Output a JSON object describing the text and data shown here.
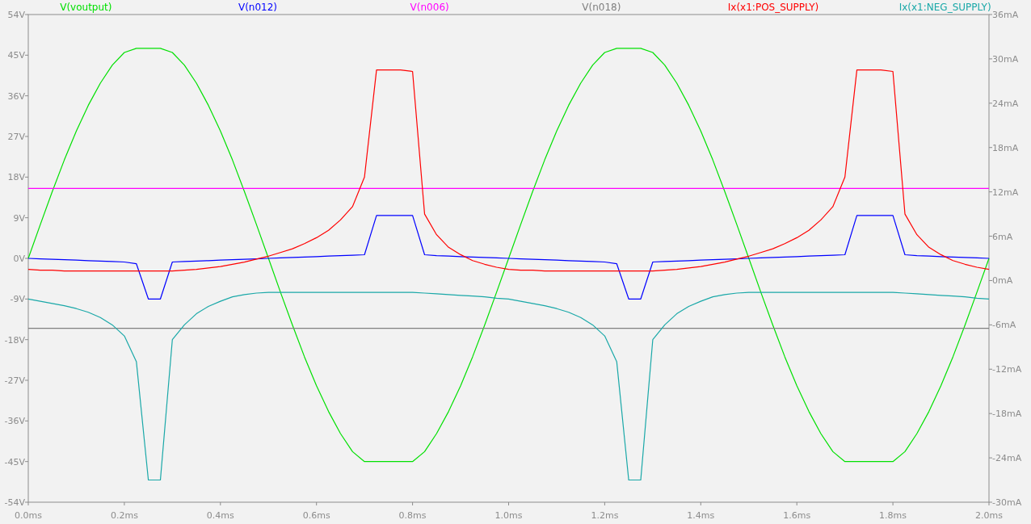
{
  "plot": {
    "chart_data": {
      "type": "line",
      "xlim": [
        0,
        2
      ],
      "ylim": [
        -54,
        54
      ],
      "y2lim": [
        -30,
        36
      ],
      "xticks": [
        {
          "value": 0,
          "label": "0.0ms"
        },
        {
          "value": 0.2,
          "label": "0.2ms"
        },
        {
          "value": 0.4,
          "label": "0.4ms"
        },
        {
          "value": 0.6,
          "label": "0.6ms"
        },
        {
          "value": 0.8,
          "label": "0.8ms"
        },
        {
          "value": 1.0,
          "label": "1.0ms"
        },
        {
          "value": 1.2,
          "label": "1.2ms"
        },
        {
          "value": 1.4,
          "label": "1.4ms"
        },
        {
          "value": 1.6,
          "label": "1.6ms"
        },
        {
          "value": 1.8,
          "label": "1.8ms"
        },
        {
          "value": 2.0,
          "label": "2.0ms"
        }
      ],
      "yticks": [
        {
          "value": 54,
          "label": "54V"
        },
        {
          "value": 45,
          "label": "45V"
        },
        {
          "value": 36,
          "label": "36V"
        },
        {
          "value": 27,
          "label": "27V"
        },
        {
          "value": 18,
          "label": "18V"
        },
        {
          "value": 9,
          "label": "9V"
        },
        {
          "value": 0,
          "label": "0V"
        },
        {
          "value": -9,
          "label": "-9V"
        },
        {
          "value": -18,
          "label": "-18V"
        },
        {
          "value": -27,
          "label": "-27V"
        },
        {
          "value": -36,
          "label": "-36V"
        },
        {
          "value": -45,
          "label": "-45V"
        },
        {
          "value": -54,
          "label": "-54V"
        }
      ],
      "y2ticks": [
        {
          "value": 36,
          "label": "36mA"
        },
        {
          "value": 30,
          "label": "30mA"
        },
        {
          "value": 24,
          "label": "24mA"
        },
        {
          "value": 18,
          "label": "18mA"
        },
        {
          "value": 12,
          "label": "12mA"
        },
        {
          "value": 6,
          "label": "6mA"
        },
        {
          "value": 0,
          "label": "0mA"
        },
        {
          "value": -6,
          "label": "-6mA"
        },
        {
          "value": -12,
          "label": "-12mA"
        },
        {
          "value": -18,
          "label": "-18mA"
        },
        {
          "value": -24,
          "label": "-24mA"
        },
        {
          "value": -30,
          "label": "-30mA"
        }
      ],
      "x": [
        0,
        0.025,
        0.05,
        0.075,
        0.1,
        0.125,
        0.15,
        0.175,
        0.2,
        0.225,
        0.25,
        0.275,
        0.3,
        0.325,
        0.35,
        0.375,
        0.4,
        0.425,
        0.45,
        0.475,
        0.5,
        0.525,
        0.55,
        0.575,
        0.6,
        0.625,
        0.65,
        0.675,
        0.7,
        0.725,
        0.75,
        0.775,
        0.8,
        0.825,
        0.85,
        0.875,
        0.9,
        0.925,
        0.95,
        0.975,
        1.0,
        1.025,
        1.05,
        1.075,
        1.1,
        1.125,
        1.15,
        1.175,
        1.2,
        1.225,
        1.25,
        1.275,
        1.3,
        1.325,
        1.35,
        1.375,
        1.4,
        1.425,
        1.45,
        1.475,
        1.5,
        1.525,
        1.55,
        1.575,
        1.6,
        1.625,
        1.65,
        1.675,
        1.7,
        1.725,
        1.75,
        1.775,
        1.8,
        1.825,
        1.85,
        1.875,
        1.9,
        1.925,
        1.95,
        1.975,
        2.0
      ],
      "series": [
        {
          "name": "V(voutput)",
          "color": "#00e000",
          "values": [
            0,
            7.5,
            14.8,
            21.8,
            28.2,
            33.9,
            38.8,
            42.8,
            45.6,
            46.5,
            46.5,
            46.5,
            45.6,
            42.8,
            38.8,
            33.9,
            28.2,
            21.8,
            14.8,
            7.5,
            0,
            -7.5,
            -14.8,
            -21.8,
            -28.2,
            -33.9,
            -38.8,
            -42.8,
            -45,
            -45,
            -45,
            -45,
            -45,
            -42.8,
            -38.8,
            -33.9,
            -28.2,
            -21.8,
            -14.8,
            -7.5,
            0,
            7.5,
            14.8,
            21.8,
            28.2,
            33.9,
            38.8,
            42.8,
            45.6,
            46.5,
            46.5,
            46.5,
            45.6,
            42.8,
            38.8,
            33.9,
            28.2,
            21.8,
            14.8,
            7.5,
            0,
            -7.5,
            -14.8,
            -21.8,
            -28.2,
            -33.9,
            -38.8,
            -42.8,
            -45,
            -45,
            -45,
            -45,
            -45,
            -42.8,
            -38.8,
            -33.9,
            -28.2,
            -21.8,
            -14.8,
            -7.5,
            0
          ]
        },
        {
          "name": "V(n012)",
          "color": "#0000ff",
          "values": [
            0,
            -0.1,
            -0.2,
            -0.3,
            -0.4,
            -0.5,
            -0.6,
            -0.7,
            -0.8,
            -1.2,
            -9,
            -9,
            -0.8,
            -0.7,
            -0.6,
            -0.5,
            -0.4,
            -0.3,
            -0.2,
            -0.1,
            0,
            0.1,
            0.2,
            0.3,
            0.4,
            0.5,
            0.6,
            0.7,
            0.8,
            9.5,
            9.5,
            9.5,
            9.5,
            0.8,
            0.6,
            0.5,
            0.4,
            0.3,
            0.2,
            0.1,
            0,
            -0.1,
            -0.2,
            -0.3,
            -0.4,
            -0.5,
            -0.6,
            -0.7,
            -0.8,
            -1.2,
            -9,
            -9,
            -0.8,
            -0.7,
            -0.6,
            -0.5,
            -0.4,
            -0.3,
            -0.2,
            -0.1,
            0,
            0.1,
            0.2,
            0.3,
            0.4,
            0.5,
            0.6,
            0.7,
            0.8,
            9.5,
            9.5,
            9.5,
            9.5,
            0.8,
            0.6,
            0.5,
            0.4,
            0.3,
            0.2,
            0.1,
            0
          ]
        },
        {
          "name": "V(n006)",
          "color": "#ff00ff",
          "values": [
            15.5,
            15.5,
            15.5,
            15.5,
            15.5,
            15.5,
            15.5,
            15.5,
            15.5,
            15.5,
            15.5,
            15.5,
            15.5,
            15.5,
            15.5,
            15.5,
            15.5,
            15.5,
            15.5,
            15.5,
            15.5,
            15.5,
            15.5,
            15.5,
            15.5,
            15.5,
            15.5,
            15.5,
            15.5,
            15.5,
            15.5,
            15.5,
            15.5,
            15.5,
            15.5,
            15.5,
            15.5,
            15.5,
            15.5,
            15.5,
            15.5,
            15.5,
            15.5,
            15.5,
            15.5,
            15.5,
            15.5,
            15.5,
            15.5,
            15.5,
            15.5,
            15.5,
            15.5,
            15.5,
            15.5,
            15.5,
            15.5,
            15.5,
            15.5,
            15.5,
            15.5,
            15.5,
            15.5,
            15.5,
            15.5,
            15.5,
            15.5,
            15.5,
            15.5,
            15.5,
            15.5,
            15.5,
            15.5,
            15.5,
            15.5,
            15.5,
            15.5,
            15.5,
            15.5,
            15.5,
            15.5
          ]
        },
        {
          "name": "V(n018)",
          "color": "#808080",
          "values": [
            -15.5,
            -15.5,
            -15.5,
            -15.5,
            -15.5,
            -15.5,
            -15.5,
            -15.5,
            -15.5,
            -15.5,
            -15.5,
            -15.5,
            -15.5,
            -15.5,
            -15.5,
            -15.5,
            -15.5,
            -15.5,
            -15.5,
            -15.5,
            -15.5,
            -15.5,
            -15.5,
            -15.5,
            -15.5,
            -15.5,
            -15.5,
            -15.5,
            -15.5,
            -15.5,
            -15.5,
            -15.5,
            -15.5,
            -15.5,
            -15.5,
            -15.5,
            -15.5,
            -15.5,
            -15.5,
            -15.5,
            -15.5,
            -15.5,
            -15.5,
            -15.5,
            -15.5,
            -15.5,
            -15.5,
            -15.5,
            -15.5,
            -15.5,
            -15.5,
            -15.5,
            -15.5,
            -15.5,
            -15.5,
            -15.5,
            -15.5,
            -15.5,
            -15.5,
            -15.5,
            -15.5,
            -15.5,
            -15.5,
            -15.5,
            -15.5,
            -15.5,
            -15.5,
            -15.5,
            -15.5,
            -15.5,
            -15.5,
            -15.5,
            -15.5,
            -15.5,
            -15.5,
            -15.5,
            -15.5,
            -15.5,
            -15.5,
            -15.5,
            -15.5
          ]
        },
        {
          "name": "Ix(x1:POS_SUPPLY)",
          "color": "#ff0000",
          "axis": "y2",
          "values": [
            1.5,
            1.4,
            1.4,
            1.3,
            1.3,
            1.3,
            1.3,
            1.3,
            1.3,
            1.3,
            1.3,
            1.3,
            1.3,
            1.4,
            1.5,
            1.7,
            1.9,
            2.2,
            2.5,
            2.9,
            3.3,
            3.8,
            4.3,
            5.0,
            5.8,
            6.8,
            8.2,
            10,
            14,
            28.5,
            28.5,
            28.5,
            28.3,
            9,
            6.2,
            4.5,
            3.5,
            2.7,
            2.2,
            1.8,
            1.5,
            1.4,
            1.4,
            1.3,
            1.3,
            1.3,
            1.3,
            1.3,
            1.3,
            1.3,
            1.3,
            1.3,
            1.3,
            1.4,
            1.5,
            1.7,
            1.9,
            2.2,
            2.5,
            2.9,
            3.3,
            3.8,
            4.3,
            5.0,
            5.8,
            6.8,
            8.2,
            10,
            14,
            28.5,
            28.5,
            28.5,
            28.3,
            9,
            6.2,
            4.5,
            3.5,
            2.7,
            2.2,
            1.8,
            1.5
          ]
        },
        {
          "name": "Ix(x1:NEG_SUPPLY)",
          "color": "#1aa8a8",
          "axis": "y2",
          "values": [
            -2.5,
            -2.8,
            -3.1,
            -3.4,
            -3.8,
            -4.3,
            -5,
            -6,
            -7.5,
            -11,
            -27,
            -27,
            -8,
            -6,
            -4.5,
            -3.5,
            -2.8,
            -2.2,
            -1.9,
            -1.7,
            -1.6,
            -1.6,
            -1.6,
            -1.6,
            -1.6,
            -1.6,
            -1.6,
            -1.6,
            -1.6,
            -1.6,
            -1.6,
            -1.6,
            -1.6,
            -1.7,
            -1.8,
            -1.9,
            -2,
            -2.1,
            -2.2,
            -2.4,
            -2.5,
            -2.8,
            -3.1,
            -3.4,
            -3.8,
            -4.3,
            -5,
            -6,
            -7.5,
            -11,
            -27,
            -27,
            -8,
            -6,
            -4.5,
            -3.5,
            -2.8,
            -2.2,
            -1.9,
            -1.7,
            -1.6,
            -1.6,
            -1.6,
            -1.6,
            -1.6,
            -1.6,
            -1.6,
            -1.6,
            -1.6,
            -1.6,
            -1.6,
            -1.6,
            -1.6,
            -1.7,
            -1.8,
            -1.9,
            -2,
            -2.1,
            -2.2,
            -2.4,
            -2.5
          ]
        }
      ]
    }
  }
}
